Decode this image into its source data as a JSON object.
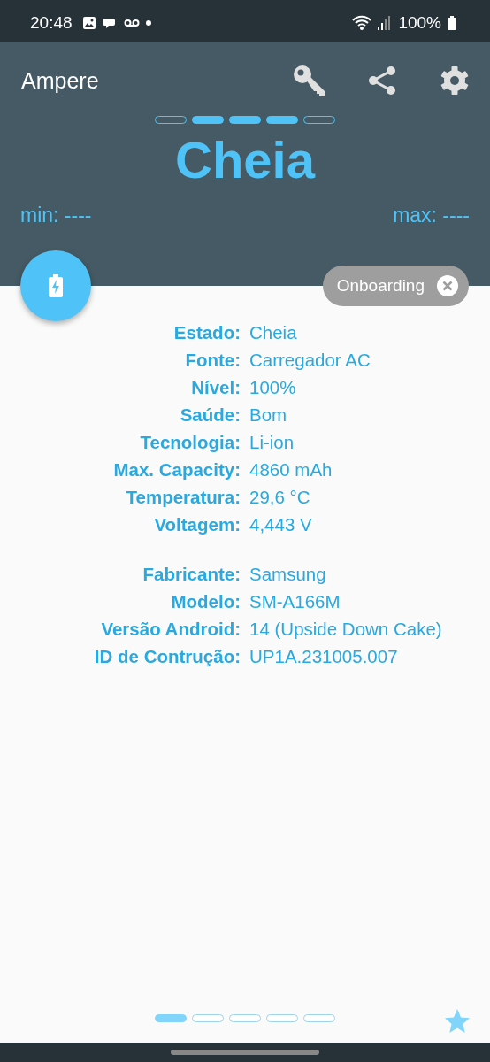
{
  "status_bar": {
    "time": "20:48",
    "battery": "100%"
  },
  "app_bar": {
    "title": "Ampere"
  },
  "charge_segments": [
    {
      "filled": false
    },
    {
      "filled": true
    },
    {
      "filled": true
    },
    {
      "filled": true
    },
    {
      "filled": false
    }
  ],
  "state": "Cheia",
  "min": "min: ----",
  "max": "max: ----",
  "chip": {
    "label": "Onboarding"
  },
  "details": [
    [
      {
        "label": "Estado:",
        "value": "Cheia"
      },
      {
        "label": "Fonte:",
        "value": "Carregador AC"
      },
      {
        "label": "Nível:",
        "value": "100%"
      },
      {
        "label": "Saúde:",
        "value": "Bom"
      },
      {
        "label": "Tecnologia:",
        "value": "Li-ion"
      },
      {
        "label": "Max. Capacity:",
        "value": "4860 mAh"
      },
      {
        "label": "Temperatura:",
        "value": "29,6 °C"
      },
      {
        "label": "Voltagem:",
        "value": "4,443 V"
      }
    ],
    [
      {
        "label": "Fabricante:",
        "value": "Samsung"
      },
      {
        "label": "Modelo:",
        "value": "SM-A166M"
      },
      {
        "label": "Versão Android:",
        "value": "14 (Upside Down Cake)"
      },
      {
        "label": "ID de Contrução:",
        "value": "UP1A.231005.007"
      }
    ]
  ],
  "pages": [
    {
      "selected": true
    },
    {
      "selected": false
    },
    {
      "selected": false
    },
    {
      "selected": false
    },
    {
      "selected": false
    }
  ]
}
